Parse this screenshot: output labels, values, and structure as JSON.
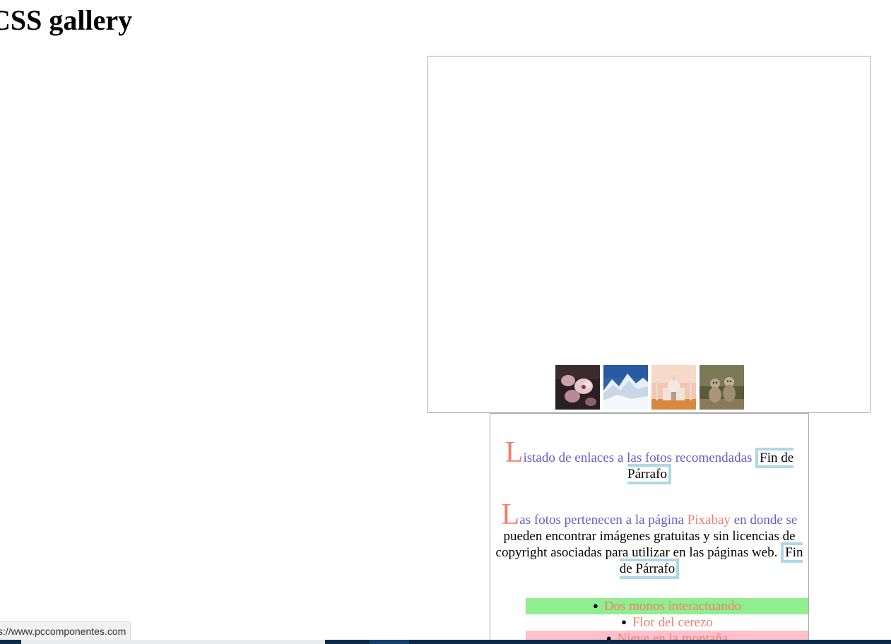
{
  "page": {
    "title": "CSS gallery"
  },
  "gallery": {
    "thumbnails": [
      {
        "label": "Flor del cerezo",
        "icon": "cherry-blossom-photo"
      },
      {
        "label": "Nieve en la montaña",
        "icon": "snowy-mountain-photo"
      },
      {
        "label": "Taj Mahal",
        "icon": "taj-mahal-photo"
      },
      {
        "label": "Dos monos interactuando",
        "icon": "monkeys-photo"
      }
    ]
  },
  "info": {
    "para1": {
      "dropcap": "L",
      "text": "istado de enlaces a las fotos recomendadas",
      "end_mark": "Fin de Párrafo"
    },
    "para2": {
      "dropcap": "L",
      "text_blue": "as fotos pertenecen a la página ",
      "link": "Pixabay",
      "text_blue2": " en donde se",
      "text_black": " pueden encontrar imágenes gratuitas y sin licencias de copyright asociadas para utilizar en las páginas web.",
      "end_mark": "Fin de Párrafo"
    },
    "list": [
      "Dos monos interactuando",
      "Flor del cerezo",
      "Nieve en la montaña"
    ]
  },
  "browser": {
    "status_url": "s://www.pccomponentes.com"
  },
  "colors": {
    "accent_coral": "#f07f6e",
    "text_blue": "#6a5acd",
    "border_lightblue": "#add8e6",
    "row_green": "#90ee90",
    "row_pink": "#ffc0cb"
  }
}
